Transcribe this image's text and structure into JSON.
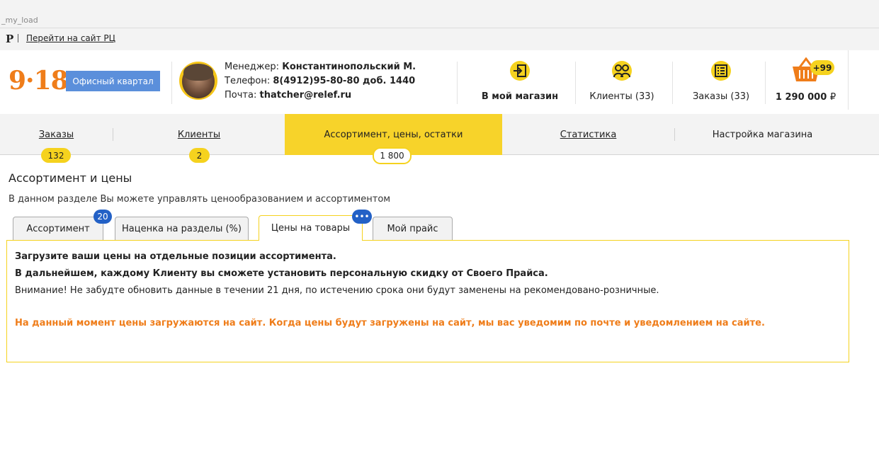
{
  "browser": {
    "url_text": "_my_load"
  },
  "topline": {
    "logo_letter": "Р",
    "goto_link": "Перейти на сайт РЦ"
  },
  "header": {
    "logo": "9·18",
    "office_button": "Офисный квартал",
    "manager_label": "Менеджер:",
    "manager_name": "Константинопольский М.",
    "phone_label": "Телефон:",
    "phone_value": "8(4912)95-80-80 доб. 1440",
    "email_label": "Почта:",
    "email_value": "thatcher@relef.ru",
    "items": [
      {
        "label": "В мой магазин",
        "icon": "login-icon"
      },
      {
        "label": "Клиенты (33)",
        "icon": "users-icon"
      },
      {
        "label": "Заказы (33)",
        "icon": "list-icon"
      }
    ],
    "cart": {
      "badge": "+99",
      "sum": "1 290 000",
      "currency": "₽",
      "icon": "basket-icon"
    }
  },
  "navbar": {
    "tabs": [
      {
        "label": "Заказы",
        "badge": "132"
      },
      {
        "label": "Клиенты",
        "badge": "2"
      },
      {
        "label": "Ассортимент, цены, остатки",
        "badge": "1 800"
      },
      {
        "label": "Статистика"
      },
      {
        "label": "Настройка магазина"
      }
    ]
  },
  "main": {
    "title": "Ассортимент и цены",
    "description": "В данном разделе Вы можете управлять ценообразованием и ассортиментом",
    "subtabs": [
      {
        "label": "Ассортимент",
        "badge": "20"
      },
      {
        "label": "Наценка на разделы (%)"
      },
      {
        "label": "Цены на товары",
        "badge": "•••"
      },
      {
        "label": "Мой прайс"
      }
    ],
    "lines": [
      "Загрузите ваши цены на отдельные позиции ассортимента.",
      "В дальнейшем, каждому Клиенту вы сможете установить персональную скидку от Своего Прайса.",
      "Внимание! Не забудте обновить данные в течении 21 дня, по истечению срока они будут заменены на рекомендовано-розничные.",
      "На данный момент цены загружаются на сайт. Когда цены будут загружены на сайт, мы вас уведомим по почте и уведомлением на сайте."
    ]
  },
  "colors": {
    "accent": "#f5d21e",
    "brand_orange": "#ef7d1a",
    "button_blue": "#5b8fdb",
    "badge_blue": "#2361c6"
  }
}
